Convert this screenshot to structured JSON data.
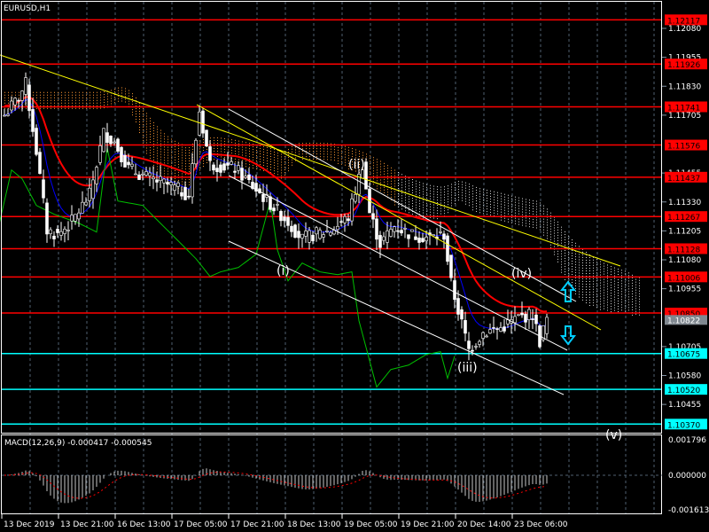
{
  "chart_title": "EURUSD,H1",
  "macd_label": "MACD(12,26,9) -0.000417 -0.000545",
  "colors": {
    "background": "#000000",
    "candle": "#ffffff",
    "bull_body": "#000000",
    "bear_body": "#ffffff",
    "ma": "#ff0000",
    "kijun": "#0000ff",
    "chikou": "#00c000",
    "cloud": "#ff9933",
    "cloud2": "#dddddd",
    "resistance": "#ff0000",
    "support": "#00ffff",
    "trend": "#ffff00",
    "channel": "#ffffff",
    "current": "#808890"
  },
  "chart_data": {
    "type": "candlestick",
    "symbol": "EURUSD",
    "timeframe": "H1",
    "ylim": [
      1.1027,
      1.1223
    ],
    "y_ticks": [
      "1.12080",
      "1.11955",
      "1.11830",
      "1.11705",
      "1.11455",
      "1.11330",
      "1.11205",
      "1.11080",
      "1.10955",
      "1.10705",
      "1.10580",
      "1.10455"
    ],
    "x_ticks": [
      "13 Dec 2019",
      "13 Dec 21:00",
      "16 Dec 13:00",
      "17 Dec 05:00",
      "17 Dec 21:00",
      "18 Dec 13:00",
      "19 Dec 05:00",
      "19 Dec 21:00",
      "20 Dec 14:00",
      "23 Dec 06:00"
    ],
    "close_waypoints": [
      [
        0,
        1.11705
      ],
      [
        4,
        1.11781
      ],
      [
        6,
        1.11839
      ],
      [
        9,
        1.11551
      ],
      [
        12,
        1.11207
      ],
      [
        15,
        1.11188
      ],
      [
        19,
        1.11245
      ],
      [
        24,
        1.1136
      ],
      [
        28,
        1.11628
      ],
      [
        31,
        1.1159
      ],
      [
        35,
        1.11475
      ],
      [
        40,
        1.11437
      ],
      [
        47,
        1.11398
      ],
      [
        52,
        1.1136
      ],
      [
        55,
        1.11724
      ],
      [
        58,
        1.11494
      ],
      [
        65,
        1.11475
      ],
      [
        70,
        1.11398
      ],
      [
        75,
        1.11322
      ],
      [
        80,
        1.11245
      ],
      [
        84,
        1.11168
      ],
      [
        87,
        1.11188
      ],
      [
        92,
        1.11207
      ],
      [
        97,
        1.11264
      ],
      [
        101,
        1.11494
      ],
      [
        103,
        1.11283
      ],
      [
        106,
        1.11149
      ],
      [
        110,
        1.11226
      ],
      [
        115,
        1.11188
      ],
      [
        120,
        1.11176
      ],
      [
        124,
        1.11188
      ],
      [
        126,
        1.10977
      ],
      [
        128,
        1.10862
      ],
      [
        131,
        1.1069
      ],
      [
        135,
        1.10766
      ],
      [
        140,
        1.10785
      ],
      [
        145,
        1.10831
      ],
      [
        149,
        1.10843
      ],
      [
        151,
        1.10728
      ],
      [
        153,
        1.10824
      ]
    ],
    "levels_resistance": [
      "1.12117",
      "1.11926",
      "1.11741",
      "1.11576",
      "1.11437",
      "1.11267",
      "1.11128",
      "1.11006",
      "1.10850"
    ],
    "levels_support": [
      "1.10675",
      "1.10520",
      "1.10370"
    ],
    "current_price": "1.10822",
    "wave_labels": [
      "(i)",
      "(ii)",
      "(iii)",
      "(iv)",
      "(v)"
    ],
    "macd": {
      "params": "12,26,9",
      "main": -0.000417,
      "signal": -0.000545,
      "ylim_labels": [
        "0.001796",
        "0.000000",
        "-0.001613"
      ],
      "ylim": [
        -0.001613,
        0.001796
      ]
    }
  }
}
